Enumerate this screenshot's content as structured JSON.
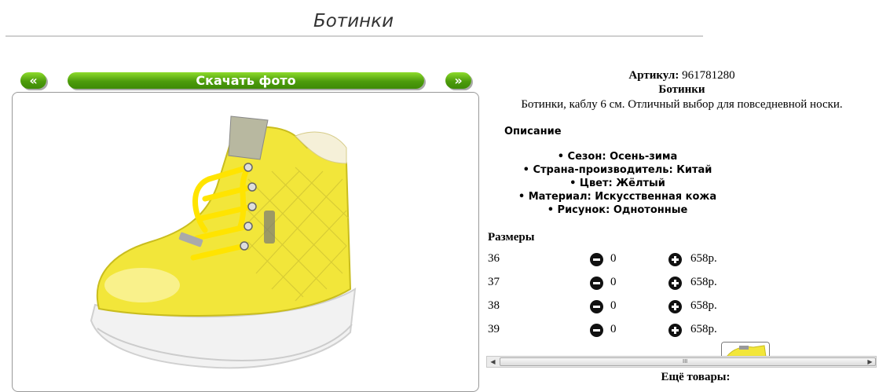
{
  "page": {
    "title": "Ботинки"
  },
  "gallery": {
    "prev_label": "«",
    "download_label": "Скачать фото",
    "next_label": "»"
  },
  "product": {
    "sku_label": "Артикул:",
    "sku_value": "961781280",
    "name": "Ботинки",
    "short_description": "Ботинки, каблу 6 см. Отличный выбор для повседневной носки.",
    "description_heading": "Описание",
    "properties": [
      "• Сезон: Осень-зима",
      "• Страна-производитель: Китай",
      "• Цвет: Жёлтый",
      "• Материал: Искусственная кожа",
      "• Рисунок: Однотонные"
    ]
  },
  "sizes": {
    "heading": "Размеры",
    "rows": [
      {
        "size": "36",
        "qty": "0",
        "price": "658р."
      },
      {
        "size": "37",
        "qty": "0",
        "price": "658р."
      },
      {
        "size": "38",
        "qty": "0",
        "price": "658р."
      },
      {
        "size": "39",
        "qty": "0",
        "price": "658р."
      }
    ]
  },
  "scrollbar": {
    "grip": "III"
  },
  "more": {
    "label": "Ещё товары:"
  },
  "colors": {
    "accent_green": "#4d9c0c",
    "shoe_yellow": "#f2e63a"
  },
  "icons": {
    "minus": "minus-circle-icon",
    "plus": "plus-circle-icon"
  }
}
